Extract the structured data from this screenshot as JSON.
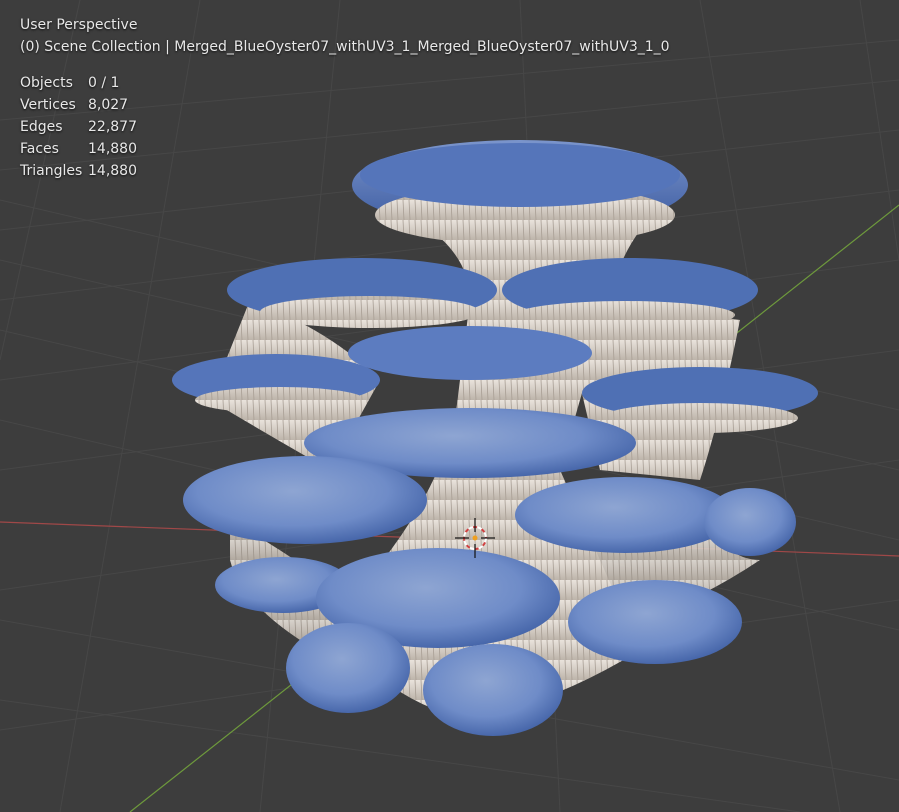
{
  "viewport": {
    "view_name": "User Perspective",
    "collection_path": "(0) Scene Collection | Merged_BlueOyster07_withUV3_1_Merged_BlueOyster07_withUV3_1_0"
  },
  "stats": [
    {
      "label": "Objects",
      "value": "0 / 1"
    },
    {
      "label": "Vertices",
      "value": "8,027"
    },
    {
      "label": "Edges",
      "value": "22,877"
    },
    {
      "label": "Faces",
      "value": "14,880"
    },
    {
      "label": "Triangles",
      "value": "14,880"
    }
  ],
  "colors": {
    "background": "#3d3d3d",
    "grid_line": "#4a4a4a",
    "x_axis": "#a04848",
    "y_axis": "#6e9a3c",
    "cap_blue": "#5878b8",
    "cap_dark": "#3d5ca0",
    "gill": "#d8d0c8"
  },
  "icons": {
    "cursor": "3d-cursor-icon"
  }
}
